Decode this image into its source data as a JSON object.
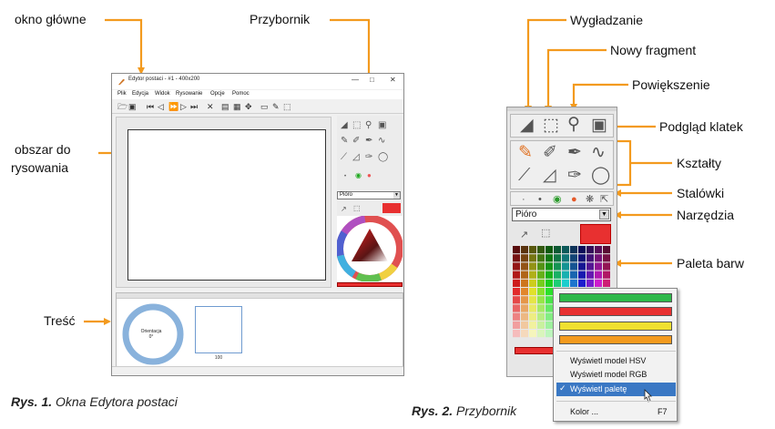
{
  "figure1": {
    "labels": {
      "okno_glowne": "okno główne",
      "przybornik": "Przybornik",
      "obszar_line1": "obszar do",
      "obszar_line2": "rysowania",
      "tresc": "Treść"
    },
    "window": {
      "title": "Edytor postaci - #1 - 400x200",
      "controls": [
        "—",
        "□",
        "✕"
      ],
      "menu": [
        "Plik",
        "Edycja",
        "Widok",
        "Rysowanie",
        "Opcje",
        "Pomoc"
      ],
      "tool_select": "Pióro",
      "frame_label_line1": "Orientacja",
      "frame_label_line2": "0°",
      "frame_number": "100"
    },
    "caption_bold": "Rys. 1.",
    "caption_text": "Okna Edytora postaci"
  },
  "figure2": {
    "labels": {
      "wygladzanie": "Wygładzanie",
      "nowy_fragment": "Nowy fragment",
      "powiekszenie": "Powiększenie",
      "podglad_klatek": "Podgląd klatek",
      "ksztalty": "Kształty",
      "stalowki": "Stalówki",
      "narzedzia": "Narzędzia",
      "paleta_barw": "Paleta barw"
    },
    "tool_select": "Pióro",
    "popup_swatches": [
      "#2eb84a",
      "#e83030",
      "#f0e030",
      "#f39a1e"
    ],
    "popup_items": [
      "Wyświetl model HSV",
      "Wyświetl model RGB",
      "Wyświetl paletę",
      "Kolor ..."
    ],
    "popup_shortcut": "F7",
    "popup_check": "✓",
    "caption_bold": "Rys. 2.",
    "caption_text": "Przybornik"
  },
  "colors": {
    "arrow_orange": "#f39a1e",
    "palette_red": "#e83030",
    "highlight_blue": "#3a78c4"
  }
}
